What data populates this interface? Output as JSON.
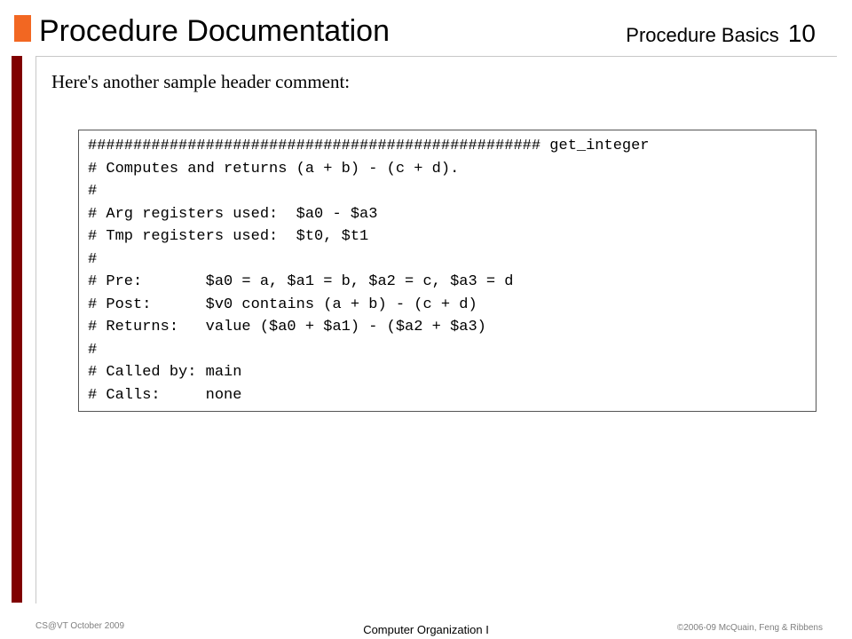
{
  "slide": {
    "title": "Procedure Documentation",
    "section": "Procedure Basics",
    "page_number": "10",
    "intro_text": "Here's another sample header comment:",
    "code_lines": [
      "################################################## get_integer",
      "# Computes and returns (a + b) - (c + d).",
      "#",
      "# Arg registers used:  $a0 - $a3",
      "# Tmp registers used:  $t0, $t1",
      "#",
      "# Pre:       $a0 = a, $a1 = b, $a2 = c, $a3 = d",
      "# Post:      $v0 contains (a + b) - (c + d)",
      "# Returns:   value ($a0 + $a1) - ($a2 + $a3)",
      "#",
      "# Called by: main",
      "# Calls:     none"
    ]
  },
  "footer": {
    "left": "CS@VT October 2009",
    "center": "Computer Organization I",
    "right": "©2006-09  McQuain, Feng & Ribbens"
  },
  "colors": {
    "accent_square": "#f26722",
    "side_bar": "#800000"
  }
}
